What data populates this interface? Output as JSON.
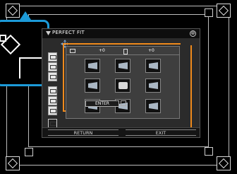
{
  "dialog": {
    "title": "PERFECT FIT",
    "close_symbol": "⊗"
  },
  "panel": {
    "horizontal_value": "+0",
    "vertical_value": "+0",
    "enter_label": "ENTER"
  },
  "footer": {
    "return_label": "RETURN",
    "exit_label": "EXIT"
  },
  "colors": {
    "accent_orange": "#f08a1c",
    "callout_blue": "#1c9ad8"
  }
}
